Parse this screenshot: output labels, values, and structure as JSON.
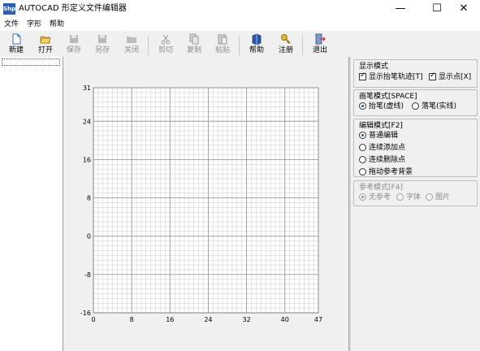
{
  "window": {
    "title": "AUTOCAD 形定义文件编辑器",
    "icon_text": "Shp",
    "minimize": "—",
    "maximize": "☐",
    "close": "✕"
  },
  "menu": {
    "file": "文件",
    "glyph": "字形",
    "help": "帮助"
  },
  "toolbar": {
    "new": "新建",
    "open": "打开",
    "save": "保存",
    "save_as": "另存",
    "close": "关闭",
    "cut": "剪切",
    "copy": "复制",
    "paste": "粘贴",
    "help": "帮助",
    "register": "注册",
    "exit": "退出"
  },
  "grid": {
    "x_ticks": [
      "0",
      "8",
      "16",
      "24",
      "32",
      "40",
      "47"
    ],
    "y_ticks": [
      "31",
      "24",
      "16",
      "8",
      "0",
      "-8",
      "-16"
    ],
    "x_range": [
      0,
      47
    ],
    "y_range": [
      -16,
      31
    ]
  },
  "panel": {
    "display": {
      "title": "显示模式",
      "show_track": "显示抬笔轨迹[T]",
      "show_track_checked": true,
      "show_points": "显示点[X]",
      "show_points_checked": true
    },
    "pen": {
      "title": "画笔模式[SPACE]",
      "up": "抬笔(虚线)",
      "down": "落笔(实线)",
      "selected": "up"
    },
    "edit": {
      "title": "编辑模式[F2]",
      "options": [
        "普通编辑",
        "连续添加点",
        "连续删除点",
        "拖动参考背景"
      ],
      "selected": 0
    },
    "ref": {
      "title": "参考模式[F4]",
      "none": "无参考",
      "font": "字体",
      "image": "图片",
      "selected": "none"
    }
  }
}
